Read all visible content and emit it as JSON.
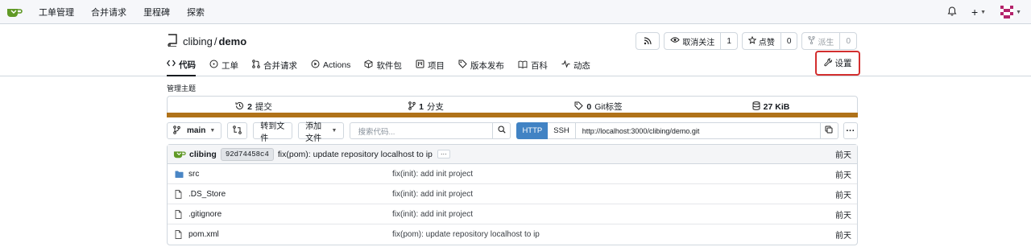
{
  "topnav": {
    "items": [
      "工单管理",
      "合并请求",
      "里程碑",
      "探索"
    ]
  },
  "repo": {
    "owner": "clibing",
    "separator": "/",
    "name": "demo",
    "unwatch_label": "取消关注",
    "watch_count": "1",
    "star_label": "点赞",
    "star_count": "0",
    "fork_label": "派生",
    "fork_count": "0"
  },
  "tabs": {
    "code": "代码",
    "issues": "工单",
    "pulls": "合并请求",
    "actions": "Actions",
    "packages": "软件包",
    "projects": "项目",
    "releases": "版本发布",
    "wiki": "百科",
    "activity": "动态",
    "settings": "设置"
  },
  "topics_label": "管理主题",
  "stats": {
    "commits_num": "2",
    "commits_label": "提交",
    "branches_num": "1",
    "branches_label": "分支",
    "tags_num": "0",
    "tags_label": "Git标签",
    "size": "27 KiB"
  },
  "language_color": "#b07219",
  "toolbar": {
    "branch": "main",
    "goto_file": "转到文件",
    "add_file": "添加文件",
    "search_placeholder": "搜索代码...",
    "http": "HTTP",
    "ssh": "SSH",
    "clone_url": "http://localhost:3000/clibing/demo.git"
  },
  "latest_commit": {
    "author": "clibing",
    "sha": "92d74458c4",
    "message": "fix(pom): update repository localhost to ip",
    "time": "前天"
  },
  "files": [
    {
      "name": "src",
      "type": "dir",
      "message": "fix(init): add init project",
      "time": "前天"
    },
    {
      "name": ".DS_Store",
      "type": "file",
      "message": "fix(init): add init project",
      "time": "前天"
    },
    {
      "name": ".gitignore",
      "type": "file",
      "message": "fix(init): add init project",
      "time": "前天"
    },
    {
      "name": "pom.xml",
      "type": "file",
      "message": "fix(pom): update repository localhost to ip",
      "time": "前天"
    }
  ]
}
